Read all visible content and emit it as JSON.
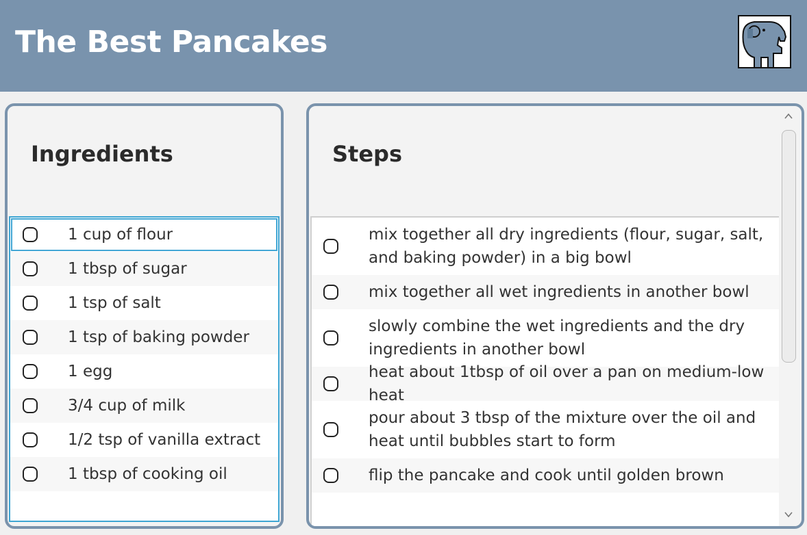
{
  "header": {
    "title": "The Best Pancakes",
    "background": "#7993ad",
    "logo_icon": "elephant-logo-icon"
  },
  "ingredients": {
    "heading": "Ingredients",
    "items": [
      {
        "label": "1 cup of flour",
        "checked": false
      },
      {
        "label": "1 tbsp of sugar",
        "checked": false
      },
      {
        "label": "1 tsp of salt",
        "checked": false
      },
      {
        "label": "1 tsp of baking powder",
        "checked": false
      },
      {
        "label": "1 egg",
        "checked": false
      },
      {
        "label": "3/4 cup of milk",
        "checked": false
      },
      {
        "label": "1/2 tsp of vanilla extract",
        "checked": false
      },
      {
        "label": "1 tbsp of cooking oil",
        "checked": false
      }
    ]
  },
  "steps": {
    "heading": "Steps",
    "items": [
      {
        "label": "mix together all dry ingredients (flour, sugar, salt, and baking powder) in a big bowl",
        "checked": false
      },
      {
        "label": "mix together all wet ingredients in another bowl",
        "checked": false
      },
      {
        "label": "slowly combine the wet ingredients and the dry ingredients in another bowl",
        "checked": false
      },
      {
        "label": "heat about 1tbsp of oil over a pan on medium-low heat",
        "checked": false
      },
      {
        "label": "pour about 3 tbsp of the mixture over the oil and heat until bubbles start to form",
        "checked": false
      },
      {
        "label": "flip the pancake and cook until golden brown",
        "checked": false
      }
    ]
  },
  "colors": {
    "accent_focus": "#43a7d5",
    "panel_border": "#7a93ac"
  }
}
